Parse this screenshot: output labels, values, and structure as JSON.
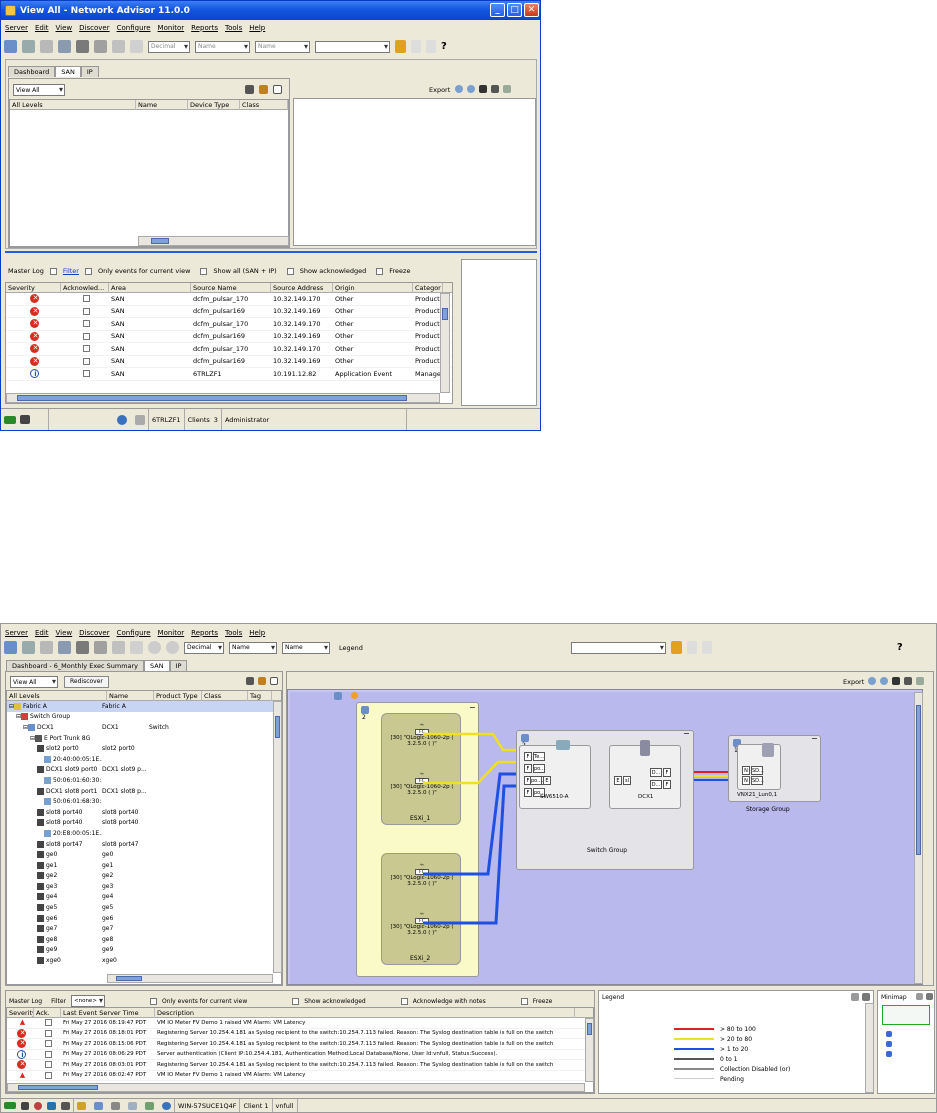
{
  "top": {
    "title": "View All - Network Advisor 11.0.0",
    "menu": [
      "Server",
      "Edit",
      "View",
      "Discover",
      "Configure",
      "Monitor",
      "Reports",
      "Tools",
      "Help"
    ],
    "toolbar_combos": [
      "Decimal",
      "Name",
      "Name"
    ],
    "tabs": [
      "Dashboard",
      "SAN",
      "IP"
    ],
    "view_all": "View All",
    "tree_headers": [
      "All Levels",
      "Name",
      "Device Type",
      "Class"
    ],
    "export": "Export",
    "log": {
      "master_log": "Master Log",
      "filter": "Filter",
      "only_events": "Only events for current view",
      "show_all": "Show all (SAN + IP)",
      "show_ack": "Show acknowledged",
      "freeze": "Freeze",
      "headers": [
        "Severity",
        "Acknowled...",
        "Area",
        "Source Name",
        "Source Address",
        "Origin",
        "Categor"
      ],
      "rows": [
        {
          "sev": "error",
          "area": "SAN",
          "source": "dcfm_pulsar_170",
          "addr": "10.32.149.170",
          "origin": "Other",
          "cat": "Product"
        },
        {
          "sev": "error",
          "area": "SAN",
          "source": "dcfm_pulsar169",
          "addr": "10.32.149.169",
          "origin": "Other",
          "cat": "Product"
        },
        {
          "sev": "error",
          "area": "SAN",
          "source": "dcfm_pulsar_170",
          "addr": "10.32.149.170",
          "origin": "Other",
          "cat": "Product"
        },
        {
          "sev": "error",
          "area": "SAN",
          "source": "dcfm_pulsar169",
          "addr": "10.32.149.169",
          "origin": "Other",
          "cat": "Product"
        },
        {
          "sev": "error",
          "area": "SAN",
          "source": "dcfm_pulsar_170",
          "addr": "10.32.149.170",
          "origin": "Other",
          "cat": "Product"
        },
        {
          "sev": "error",
          "area": "SAN",
          "source": "dcfm_pulsar169",
          "addr": "10.32.149.169",
          "origin": "Other",
          "cat": "Product"
        },
        {
          "sev": "info",
          "area": "SAN",
          "source": "6TRLZF1",
          "addr": "10.191.12.82",
          "origin": "Application Event",
          "cat": "Manage"
        }
      ]
    },
    "status": {
      "server": "6TRLZF1",
      "clients_label": "Clients",
      "clients": "3",
      "user": "Administrator"
    }
  },
  "bottom": {
    "menu": [
      "Server",
      "Edit",
      "View",
      "Discover",
      "Configure",
      "Monitor",
      "Reports",
      "Tools",
      "Help"
    ],
    "toolbar_combos": [
      "Decimal",
      "Name",
      "Name"
    ],
    "legend_label": "Legend",
    "tabs": [
      "Dashboard - 6_Monthly Exec Summary",
      "SAN",
      "IP"
    ],
    "view_all": "View All",
    "rediscover": "Rediscover",
    "tree_headers": [
      "All Levels",
      "Name",
      "Product Type",
      "Class",
      "Tag"
    ],
    "tree": [
      {
        "label": "Fabric A",
        "name": "Fabric A",
        "pt": "",
        "lvl": 0,
        "sel": true
      },
      {
        "label": "Switch Group",
        "name": "",
        "pt": "",
        "lvl": 1
      },
      {
        "label": "DCX1",
        "name": "DCX1",
        "pt": "Switch",
        "lvl": 2
      },
      {
        "label": "E Port Trunk 8G",
        "name": "",
        "pt": "",
        "lvl": 3
      },
      {
        "label": "slot2 port0",
        "name": "slot2 port0",
        "pt": "",
        "lvl": 4
      },
      {
        "label": "20:40:00:05:1E...",
        "name": "",
        "pt": "",
        "lvl": 5
      },
      {
        "label": "DCX1 slot9 port0",
        "name": "DCX1 slot9 p...",
        "pt": "",
        "lvl": 4
      },
      {
        "label": "50:06:01:60:30:...",
        "name": "",
        "pt": "",
        "lvl": 5
      },
      {
        "label": "DCX1 slot8 port1",
        "name": "DCX1 slot8 p...",
        "pt": "",
        "lvl": 4
      },
      {
        "label": "50:06:01:68:30:...",
        "name": "",
        "pt": "",
        "lvl": 5
      },
      {
        "label": "slot8 port40",
        "name": "slot8 port40",
        "pt": "",
        "lvl": 4
      },
      {
        "label": "slot8 port40",
        "name": "slot8 port40",
        "pt": "",
        "lvl": 4
      },
      {
        "label": "20:E8:00:05:1E...",
        "name": "",
        "pt": "",
        "lvl": 5
      },
      {
        "label": "slot8 port47",
        "name": "slot8 port47",
        "pt": "",
        "lvl": 4
      },
      {
        "label": "ge0",
        "name": "ge0",
        "pt": "",
        "lvl": 4
      },
      {
        "label": "ge1",
        "name": "ge1",
        "pt": "",
        "lvl": 4
      },
      {
        "label": "ge2",
        "name": "ge2",
        "pt": "",
        "lvl": 4
      },
      {
        "label": "ge3",
        "name": "ge3",
        "pt": "",
        "lvl": 4
      },
      {
        "label": "ge4",
        "name": "ge4",
        "pt": "",
        "lvl": 4
      },
      {
        "label": "ge5",
        "name": "ge5",
        "pt": "",
        "lvl": 4
      },
      {
        "label": "ge6",
        "name": "ge6",
        "pt": "",
        "lvl": 4
      },
      {
        "label": "ge7",
        "name": "ge7",
        "pt": "",
        "lvl": 4
      },
      {
        "label": "ge8",
        "name": "ge8",
        "pt": "",
        "lvl": 4
      },
      {
        "label": "ge9",
        "name": "ge9",
        "pt": "",
        "lvl": 4
      },
      {
        "label": "xge0",
        "name": "xge0",
        "pt": "",
        "lvl": 4
      }
    ],
    "topology": {
      "host_group_count": "2",
      "esxi1": "ESXi_1",
      "esxi2": "ESXi_2",
      "hba_label": "[30] \"QLogic-1060-2p (",
      "hba_ver": "3.2.5.0 ( )\"",
      "fc": "FC",
      "switch_count": "2",
      "switch_name": "SW6510-A",
      "dcx_name": "DCX1",
      "switch_group": "Switch Group",
      "storage_name": "VNX21_Lun0,1",
      "storage_group": "Storage Group",
      "storage_count": "1",
      "ports_f": [
        "Te...",
        "po...",
        "po...",
        "po..."
      ],
      "e": "E",
      "f": "F",
      "n": "N",
      "d": "D...",
      "sd": "SD..."
    },
    "log": {
      "master_log": "Master Log",
      "filter": "Filter",
      "filter_value": "<none>",
      "only_events": "Only events for current view",
      "show_ack": "Show acknowledged",
      "ack_notes": "Acknowledge with notes",
      "freeze": "Freeze",
      "headers": [
        "Severity",
        "Ack.",
        "Last Event Server Time",
        "Description"
      ],
      "rows": [
        {
          "sev": "warn",
          "time": "Fri May 27 2016 08:19:47 PDT",
          "desc": "VM IO Meter FV Demo 1 raised VM Alarm: VM Latency"
        },
        {
          "sev": "error",
          "time": "Fri May 27 2016 08:18:01 PDT",
          "desc": "Registering Server 10.254.4.181 as Syslog recipient to the switch:10.254.7.113 failed. Reason: The Syslog destination table is full on the switch"
        },
        {
          "sev": "error",
          "time": "Fri May 27 2016 08:15:06 PDT",
          "desc": "Registering Server 10.254.4.181 as Syslog recipient to the switch:10.254.7.113 failed. Reason: The Syslog destination table is full on the switch"
        },
        {
          "sev": "info",
          "time": "Fri May 27 2016 08:06:29 PDT",
          "desc": "Server authentication (Client IP:10.254.4.181, Authentication Method:Local Database/None, User Id:vnfull, Status:Success)."
        },
        {
          "sev": "error",
          "time": "Fri May 27 2016 08:03:01 PDT",
          "desc": "Registering Server 10.254.4.181 as Syslog recipient to the switch:10.254.7.113 failed. Reason: The Syslog destination table is full on the switch"
        },
        {
          "sev": "warn",
          "time": "Fri May 27 2016 08:02:47 PDT",
          "desc": "VM IO Meter FV Demo 1 raised VM Alarm: VM Latency"
        }
      ]
    },
    "legend": {
      "title": "Legend",
      "items": [
        {
          "label": "> 80 to 100",
          "color": "#e02020"
        },
        {
          "label": "> 20 to 80",
          "color": "#f0e020"
        },
        {
          "label": "> 1 to 20",
          "color": "#2050e0"
        },
        {
          "label": "0 to 1",
          "color": "#555555"
        },
        {
          "label": "Collection Disabled (or)",
          "color": "#888888"
        },
        {
          "label": "Pending",
          "color": "#ffffff"
        }
      ]
    },
    "minimap": "Minimap",
    "status": {
      "server": "WIN-57SUCE1Q4F",
      "clients": "Client 1",
      "user": "vnfull"
    }
  }
}
